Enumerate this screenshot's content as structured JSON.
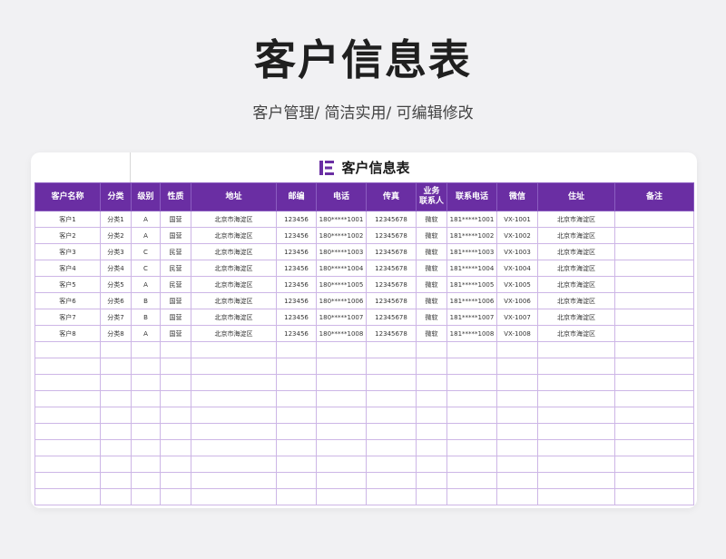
{
  "header": {
    "title": "客户信息表",
    "subtitle": "客户管理/ 简洁实用/ 可编辑修改"
  },
  "sheet": {
    "title": "客户信息表",
    "icon": "sheet-logo-icon",
    "accent": "#6a2ea3",
    "columns": [
      "客户名称",
      "分类",
      "级别",
      "性质",
      "地址",
      "邮编",
      "电话",
      "传真",
      "业务\n联系人",
      "联系电话",
      "微信",
      "住址",
      "备注"
    ],
    "rows": [
      [
        "客户1",
        "分类1",
        "A",
        "国营",
        "北京市海淀区",
        "123456",
        "180*****1001",
        "12345678",
        "微软",
        "181*****1001",
        "VX-1001",
        "北京市海淀区",
        ""
      ],
      [
        "客户2",
        "分类2",
        "A",
        "国营",
        "北京市海淀区",
        "123456",
        "180*****1002",
        "12345678",
        "微软",
        "181*****1002",
        "VX-1002",
        "北京市海淀区",
        ""
      ],
      [
        "客户3",
        "分类3",
        "C",
        "民营",
        "北京市海淀区",
        "123456",
        "180*****1003",
        "12345678",
        "微软",
        "181*****1003",
        "VX-1003",
        "北京市海淀区",
        ""
      ],
      [
        "客户4",
        "分类4",
        "C",
        "民营",
        "北京市海淀区",
        "123456",
        "180*****1004",
        "12345678",
        "微软",
        "181*****1004",
        "VX-1004",
        "北京市海淀区",
        ""
      ],
      [
        "客户5",
        "分类5",
        "A",
        "民营",
        "北京市海淀区",
        "123456",
        "180*****1005",
        "12345678",
        "微软",
        "181*****1005",
        "VX-1005",
        "北京市海淀区",
        ""
      ],
      [
        "客户6",
        "分类6",
        "B",
        "国营",
        "北京市海淀区",
        "123456",
        "180*****1006",
        "12345678",
        "微软",
        "181*****1006",
        "VX-1006",
        "北京市海淀区",
        ""
      ],
      [
        "客户7",
        "分类7",
        "B",
        "国营",
        "北京市海淀区",
        "123456",
        "180*****1007",
        "12345678",
        "微软",
        "181*****1007",
        "VX-1007",
        "北京市海淀区",
        ""
      ],
      [
        "客户8",
        "分类8",
        "A",
        "国营",
        "北京市海淀区",
        "123456",
        "180*****1008",
        "12345678",
        "微软",
        "181*****1008",
        "VX-1008",
        "北京市海淀区",
        ""
      ]
    ],
    "empty_row_count": 10
  }
}
